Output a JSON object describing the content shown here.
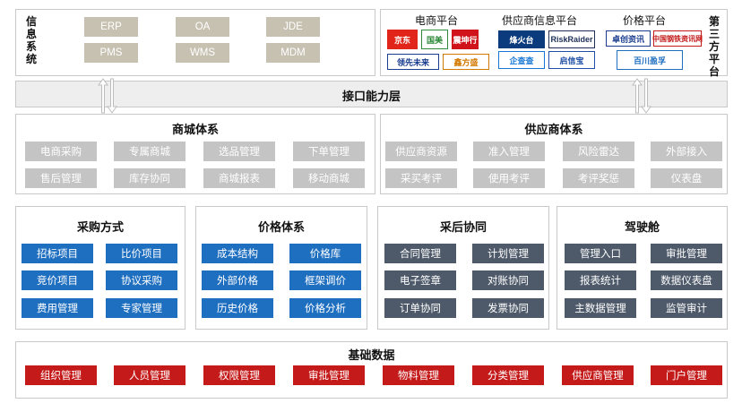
{
  "info_system": {
    "label": "信息系统",
    "items": [
      "ERP",
      "OA",
      "JDE",
      "PMS",
      "WMS",
      "MDM"
    ]
  },
  "third_party": {
    "label": "第三方平台",
    "platforms": [
      {
        "title": "电商平台",
        "logos": [
          "京东",
          "国美",
          "震坤行",
          "领先未来",
          "鑫方盛"
        ]
      },
      {
        "title": "供应商信息平台",
        "logos": [
          "烽火台",
          "RiskRaider",
          "企查查",
          "启信宝"
        ]
      },
      {
        "title": "价格平台",
        "logos": [
          "卓创资讯",
          "中国钢铁资讯网",
          "百川盈孚"
        ]
      }
    ]
  },
  "interface_layer": {
    "label": "接口能力层"
  },
  "mall_system": {
    "title": "商城体系",
    "items": [
      "电商采购",
      "专属商城",
      "选品管理",
      "下单管理",
      "售后管理",
      "库存协同",
      "商城报表",
      "移动商城"
    ]
  },
  "supplier_system": {
    "title": "供应商体系",
    "items": [
      "供应商资源",
      "准入管理",
      "风险雷达",
      "外部接入",
      "采买考评",
      "使用考评",
      "考评奖惩",
      "仪表盘"
    ]
  },
  "procurement": {
    "title": "采购方式",
    "items": [
      "招标项目",
      "比价项目",
      "竞价项目",
      "协议采购",
      "费用管理",
      "专家管理"
    ]
  },
  "pricing": {
    "title": "价格体系",
    "items": [
      "成本结构",
      "价格库",
      "外部价格",
      "框架调价",
      "历史价格",
      "价格分析"
    ]
  },
  "post_procurement": {
    "title": "采后协同",
    "items": [
      "合同管理",
      "计划管理",
      "电子签章",
      "对账协同",
      "订单协同",
      "发票协同"
    ]
  },
  "cockpit": {
    "title": "驾驶舱",
    "items": [
      "管理入口",
      "审批管理",
      "报表统计",
      "数据仪表盘",
      "主数据管理",
      "监管审计"
    ]
  },
  "base_data": {
    "title": "基础数据",
    "items": [
      "组织管理",
      "人员管理",
      "权限管理",
      "审批管理",
      "物料管理",
      "分类管理",
      "供应商管理",
      "门户管理"
    ]
  },
  "colors": {
    "grey_box": "#c4c4c4",
    "tan_box": "#c7c1b2",
    "blue_box": "#1f6fc0",
    "dark_box": "#4e5a6a",
    "red_box": "#c41a1a"
  }
}
